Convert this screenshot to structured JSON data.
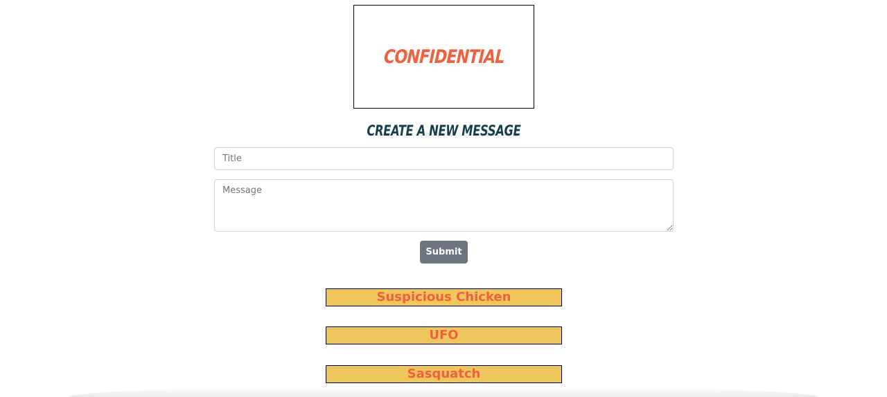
{
  "logo": {
    "text": "Confidential"
  },
  "form": {
    "heading": "Create a New Message",
    "title_placeholder": "Title",
    "message_placeholder": "Message",
    "submit_label": "Submit"
  },
  "messages": [
    {
      "title": "Suspicious Chicken"
    },
    {
      "title": "UFO"
    },
    {
      "title": "Sasquatch"
    }
  ],
  "colors": {
    "brand": "#f0603e",
    "heading": "#163f4a",
    "message_bg": "#f0c75e",
    "button_bg": "#6c757d"
  }
}
